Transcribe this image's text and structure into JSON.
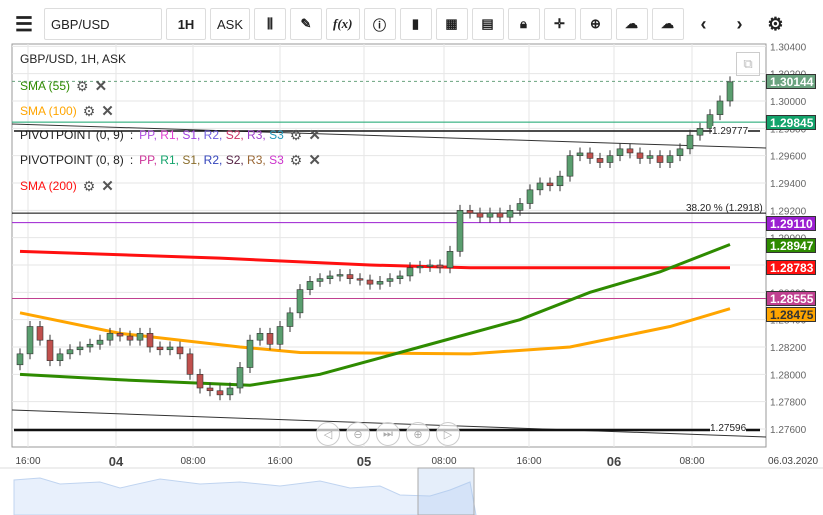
{
  "toolbar": {
    "menu_icon": "hamburger-icon",
    "symbol": "GBP/USD",
    "timeframe": "1H",
    "price_type": "ASK",
    "buttons": [
      "candle-type",
      "draw-pencil",
      "f(x)",
      "info",
      "volume",
      "calendar",
      "news",
      "lock",
      "crosshair",
      "zoom",
      "upload",
      "download",
      "prev",
      "next",
      "settings"
    ],
    "fx_label": "f(x)"
  },
  "legend": {
    "title": "GBP/USD, 1H, ASK",
    "sma55": "SMA (55)",
    "sma100": "SMA (100)",
    "pivot9": "PIVOTPOINT (0, 9)",
    "pivot8": "PIVOTPOINT (0, 8)",
    "sma200": "SMA (200)",
    "pivot_sep": ":",
    "pivot_levels": [
      "PP",
      "R1",
      "S1",
      "R2",
      "S2",
      "R3",
      "S3"
    ]
  },
  "colors": {
    "up": "#5a9e6f",
    "down": "#c0504d",
    "sma55": "#2e8b00",
    "sma100": "#ffa500",
    "sma200": "#ff1010",
    "pivot8": [
      "#cc3399",
      "#13a36b",
      "#8a6d2b",
      "#3344bb",
      "#552244",
      "#996633",
      "#cc33cc"
    ],
    "pivot9": [
      "#b050e0",
      "#e040d0",
      "#a040e0",
      "#7060e0",
      "#cc3366",
      "#a040cc",
      "#2299bb"
    ]
  },
  "price_labels": [
    {
      "value": "1.30144",
      "color": "#6aa37f"
    },
    {
      "value": "1.29845",
      "color": "#13a36b"
    },
    {
      "value": "1.29110",
      "color": "#9b1fd1"
    },
    {
      "value": "1.28947",
      "color": "#2e8b00"
    },
    {
      "value": "1.28783",
      "color": "#ff1010"
    },
    {
      "value": "1.28555",
      "color": "#c04090"
    },
    {
      "value": "1.28475",
      "color": "#ffa500"
    }
  ],
  "annotations": {
    "fib": "38.20 % (1.2918)",
    "arrow_top": "1.29777",
    "arrow_bottom": "1.27596"
  },
  "chart_data": {
    "type": "candlestick",
    "ylim": [
      1.2752,
      1.3046
    ],
    "y_ticks": [
      "1.30400",
      "1.30200",
      "1.30000",
      "1.29800",
      "1.29600",
      "1.29400",
      "1.29200",
      "1.29000",
      "1.28800",
      "1.28600",
      "1.28400",
      "1.28200",
      "1.28000",
      "1.27800",
      "1.27600"
    ],
    "x_ticks": [
      {
        "label": "16:00",
        "major": false
      },
      {
        "label": "04",
        "major": true
      },
      {
        "label": "08:00",
        "major": false
      },
      {
        "label": "16:00",
        "major": false
      },
      {
        "label": "05",
        "major": true
      },
      {
        "label": "08:00",
        "major": false
      },
      {
        "label": "16:00",
        "major": false
      },
      {
        "label": "06",
        "major": true
      },
      {
        "label": "08:00",
        "major": false
      },
      {
        "label": "06.03.2020",
        "major": false
      }
    ],
    "closes": [
      1.2815,
      1.2835,
      1.2825,
      1.281,
      1.2815,
      1.2818,
      1.282,
      1.2822,
      1.2825,
      1.283,
      1.2828,
      1.2825,
      1.283,
      1.282,
      1.2818,
      1.282,
      1.2815,
      1.28,
      1.279,
      1.2788,
      1.2785,
      1.279,
      1.2805,
      1.2825,
      1.283,
      1.2822,
      1.2835,
      1.2845,
      1.2862,
      1.2868,
      1.287,
      1.2872,
      1.2873,
      1.287,
      1.2869,
      1.2866,
      1.2868,
      1.287,
      1.2872,
      1.2878,
      1.2879,
      1.288,
      1.2878,
      1.289,
      1.292,
      1.2918,
      1.2915,
      1.2918,
      1.2915,
      1.292,
      1.2925,
      1.2935,
      1.294,
      1.2938,
      1.2945,
      1.296,
      1.2962,
      1.2958,
      1.2955,
      1.296,
      1.2965,
      1.2962,
      1.2958,
      1.296,
      1.2955,
      1.296,
      1.2965,
      1.2975,
      1.298,
      1.299,
      1.3,
      1.3014
    ],
    "sma55": [
      [
        0,
        1.28
      ],
      [
        10,
        1.2796
      ],
      [
        23,
        1.2792
      ],
      [
        30,
        1.28
      ],
      [
        40,
        1.282
      ],
      [
        50,
        1.284
      ],
      [
        57,
        1.286
      ],
      [
        64,
        1.2875
      ],
      [
        71,
        1.2895
      ]
    ],
    "sma100": [
      [
        0,
        1.2845
      ],
      [
        10,
        1.283
      ],
      [
        22,
        1.282
      ],
      [
        28,
        1.2816
      ],
      [
        45,
        1.2815
      ],
      [
        55,
        1.282
      ],
      [
        65,
        1.2835
      ],
      [
        71,
        1.2848
      ]
    ],
    "sma200": [
      [
        0,
        1.289
      ],
      [
        20,
        1.2885
      ],
      [
        35,
        1.288
      ],
      [
        45,
        1.2878
      ],
      [
        71,
        1.2878
      ]
    ],
    "hlines": [
      {
        "p": 1.29845,
        "c": "#13a36b"
      },
      {
        "p": 1.2918,
        "c": "#000"
      },
      {
        "p": 1.2911,
        "c": "#9b1fd1"
      },
      {
        "p": 1.28555,
        "c": "#c04090"
      },
      {
        "p": 1.30144,
        "c": "#6aa37f",
        "dash": true
      }
    ]
  },
  "navigator": {
    "buttons": [
      "scroll-left",
      "zoom-out",
      "go-latest",
      "zoom-in",
      "scroll-right"
    ]
  }
}
